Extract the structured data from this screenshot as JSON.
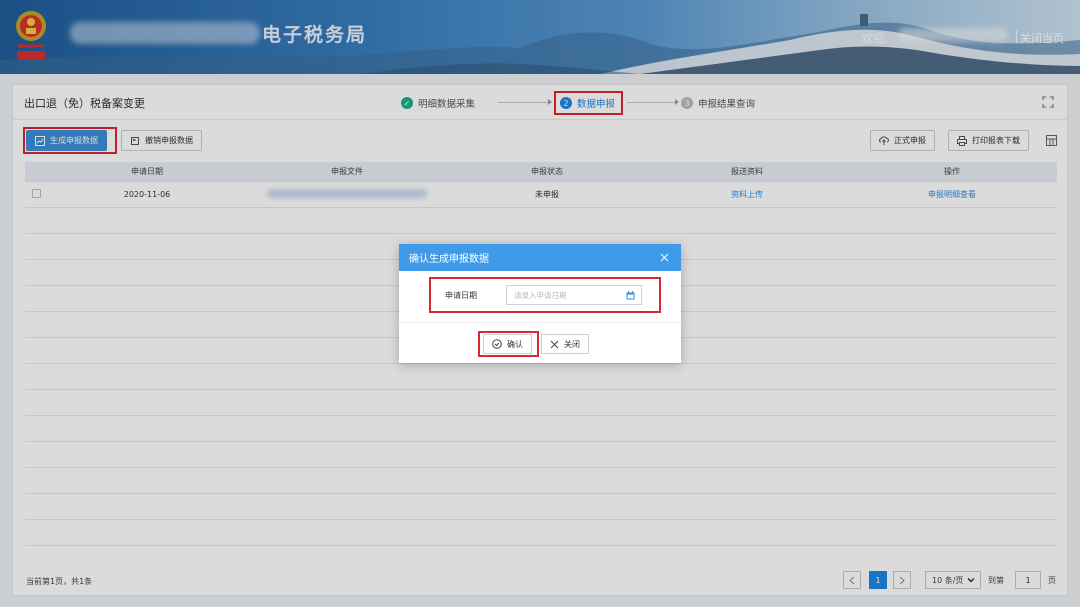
{
  "header": {
    "brand": "电子税务局",
    "welcome": "欢迎,",
    "close_page": "关闭当页"
  },
  "page": {
    "title": "出口退（免）税备案变更",
    "steps": [
      {
        "num": "✓",
        "label": "明细数据采集",
        "state": "done"
      },
      {
        "num": "2",
        "label": "数据申报",
        "state": "active"
      },
      {
        "num": "3",
        "label": "申报结果查询",
        "state": "pending"
      }
    ]
  },
  "toolbar": {
    "generate": "生成申报数据",
    "withdraw": "撤销申报数据",
    "formal": "正式申报",
    "print": "打印报表下载"
  },
  "table": {
    "headers": [
      "申请日期",
      "申报文件",
      "申报状态",
      "报送资料",
      "操作"
    ],
    "rows": [
      {
        "date": "2020-11-06",
        "status": "未申报",
        "upload": "资料上传",
        "action": "申报明细查看"
      }
    ]
  },
  "footer": {
    "info": "当前第1页，共1条",
    "current_page": "1",
    "page_size": "10 条/页",
    "goto": "到第",
    "goto_value": "1",
    "page_unit": "页"
  },
  "dialog": {
    "title": "确认生成申报数据",
    "field_label": "申请日期",
    "field_placeholder": "请录入申请日期",
    "confirm": "确认",
    "cancel": "关闭"
  },
  "colors": {
    "primary": "#1e88e5",
    "dialog_header": "#3f9bea",
    "highlight": "#d9282f",
    "success": "#19b28a"
  }
}
